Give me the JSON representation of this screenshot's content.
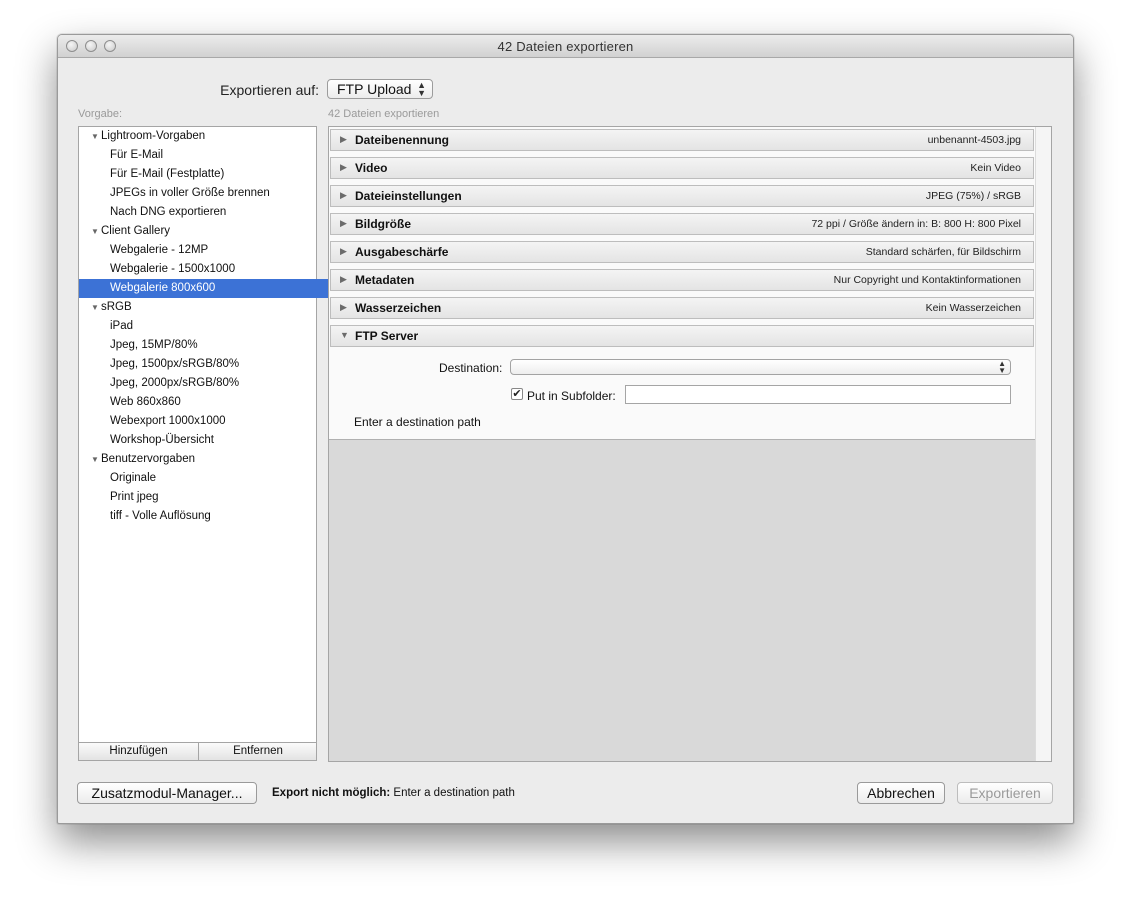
{
  "window": {
    "title": "42 Dateien exportieren"
  },
  "export_target": {
    "label": "Exportieren auf:",
    "value": "FTP Upload"
  },
  "preset_header": "Vorgabe:",
  "panel_header": "42 Dateien exportieren",
  "presets": [
    {
      "label": "Lightroom-Vorgaben",
      "type": "folder"
    },
    {
      "label": "Für E-Mail",
      "type": "child"
    },
    {
      "label": "Für E-Mail (Festplatte)",
      "type": "child"
    },
    {
      "label": "JPEGs in voller Größe brennen",
      "type": "child"
    },
    {
      "label": "Nach DNG exportieren",
      "type": "child"
    },
    {
      "label": "Client Gallery",
      "type": "folder"
    },
    {
      "label": "Webgalerie - 12MP",
      "type": "child"
    },
    {
      "label": "Webgalerie - 1500x1000",
      "type": "child"
    },
    {
      "label": "Webgalerie 800x600",
      "type": "child",
      "selected": true
    },
    {
      "label": "sRGB",
      "type": "folder"
    },
    {
      "label": "iPad",
      "type": "child"
    },
    {
      "label": "Jpeg, 15MP/80%",
      "type": "child"
    },
    {
      "label": "Jpeg, 1500px/sRGB/80%",
      "type": "child"
    },
    {
      "label": "Jpeg, 2000px/sRGB/80%",
      "type": "child"
    },
    {
      "label": "Web 860x860",
      "type": "child"
    },
    {
      "label": "Webexport 1000x1000",
      "type": "child"
    },
    {
      "label": "Workshop-Übersicht",
      "type": "child"
    },
    {
      "label": "Benutzervorgaben",
      "type": "folder"
    },
    {
      "label": "Originale",
      "type": "child"
    },
    {
      "label": "Print jpeg",
      "type": "child"
    },
    {
      "label": "tiff - Volle Auflösung",
      "type": "child"
    }
  ],
  "list_buttons": {
    "add": "Hinzufügen",
    "remove": "Entfernen"
  },
  "sections": [
    {
      "title": "Dateibenennung",
      "summary": "unbenannt-4503.jpg",
      "expanded": false
    },
    {
      "title": "Video",
      "summary": "Kein Video",
      "expanded": false
    },
    {
      "title": "Dateieinstellungen",
      "summary": "JPEG (75%) / sRGB",
      "expanded": false
    },
    {
      "title": "Bildgröße",
      "summary": "72 ppi / Größe ändern in: B: 800 H: 800 Pixel",
      "expanded": false
    },
    {
      "title": "Ausgabeschärfe",
      "summary": "Standard schärfen, für Bildschirm",
      "expanded": false
    },
    {
      "title": "Metadaten",
      "summary": "Nur Copyright und Kontaktinformationen",
      "expanded": false
    },
    {
      "title": "Wasserzeichen",
      "summary": "Kein Wasserzeichen",
      "expanded": false
    },
    {
      "title": "FTP Server",
      "summary": "",
      "expanded": true
    }
  ],
  "ftp": {
    "destination_label": "Destination:",
    "destination_value": "",
    "subfolder_label": "Put in Subfolder:",
    "subfolder_checked": true,
    "subfolder_value": "",
    "hint": "Enter a destination path"
  },
  "footer": {
    "plugin_manager": "Zusatzmodul-Manager...",
    "status_bold": "Export nicht möglich:",
    "status_text": "Enter a destination path",
    "cancel": "Abbrechen",
    "export": "Exportieren"
  },
  "colors": {
    "selection": "#3c72d6"
  }
}
